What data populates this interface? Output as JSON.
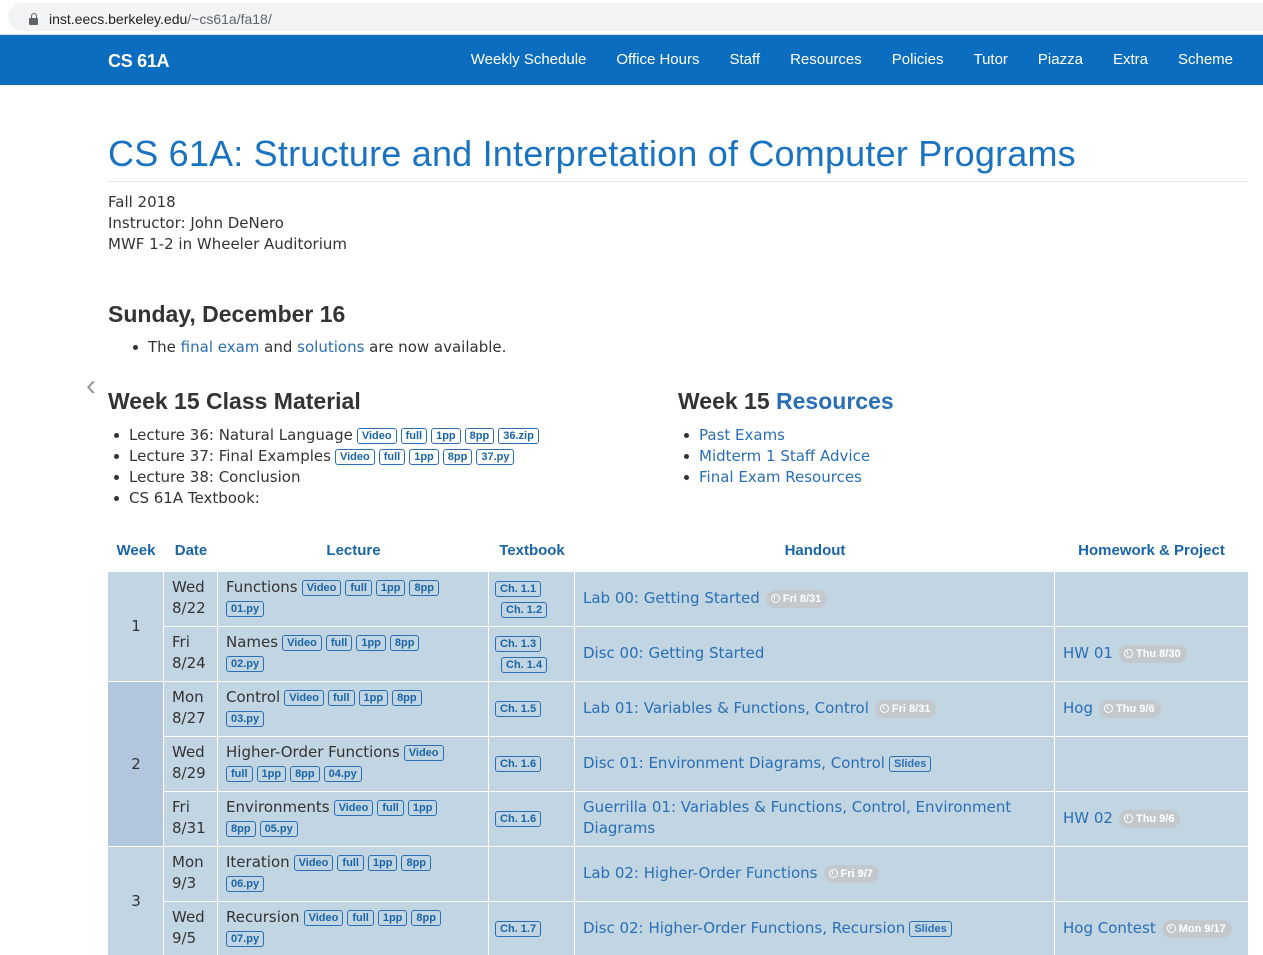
{
  "browser": {
    "host": "inst.eecs.berkeley.edu",
    "path": "/~cs61a/fa18/"
  },
  "nav": {
    "brand": "CS 61A",
    "links": [
      "Weekly Schedule",
      "Office Hours",
      "Staff",
      "Resources",
      "Policies",
      "Tutor",
      "Piazza",
      "Extra",
      "Scheme"
    ]
  },
  "header": {
    "title": "CS 61A: Structure and Interpretation of Computer Programs",
    "term": "Fall 2018",
    "instructor": "Instructor: John DeNero",
    "meeting": "MWF 1-2 in Wheeler Auditorium"
  },
  "announcement": {
    "date": "Sunday, December 16",
    "text_1": "The ",
    "link_1": "final exam",
    "text_2": " and ",
    "link_2": "solutions",
    "text_3": " are now available."
  },
  "material": {
    "heading": "Week 15 Class Material",
    "items": [
      {
        "label": "Lecture 36: Natural Language",
        "tags": [
          "Video",
          "full",
          "1pp",
          "8pp",
          "36.zip"
        ]
      },
      {
        "label": "Lecture 37: Final Examples",
        "tags": [
          "Video",
          "full",
          "1pp",
          "8pp",
          "37.py"
        ]
      },
      {
        "label": "Lecture 38: Conclusion",
        "tags": []
      },
      {
        "label": "CS 61A Textbook:",
        "tags": []
      }
    ]
  },
  "resources": {
    "heading_prefix": "Week 15 ",
    "heading_link": "Resources",
    "items": [
      "Past Exams",
      "Midterm 1 Staff Advice",
      "Final Exam Resources"
    ]
  },
  "table": {
    "headers": [
      "Week",
      "Date",
      "Lecture",
      "Textbook",
      "Handout",
      "Homework & Project"
    ],
    "weeks": [
      "1",
      "2",
      "3"
    ],
    "rows": [
      {
        "day": "Wed",
        "date": "8/22",
        "lecture": "Functions",
        "lec_tags_1": [
          "Video",
          "full",
          "1pp",
          "8pp"
        ],
        "lec_tags_2": [
          "01.py"
        ],
        "text": [
          "Ch. 1.1",
          "Ch. 1.2"
        ],
        "handout": "Lab 00: Getting Started",
        "handout_due": "Fri 8/31",
        "handout_tag": "",
        "hw": "",
        "hw_due": ""
      },
      {
        "day": "Fri",
        "date": "8/24",
        "lecture": "Names",
        "lec_tags_1": [
          "Video",
          "full",
          "1pp",
          "8pp"
        ],
        "lec_tags_2": [
          "02.py"
        ],
        "text": [
          "Ch. 1.3",
          "Ch. 1.4"
        ],
        "handout": "Disc 00: Getting Started",
        "handout_due": "",
        "handout_tag": "",
        "hw": "HW 01",
        "hw_due": "Thu 8/30"
      },
      {
        "day": "Mon",
        "date": "8/27",
        "lecture": "Control",
        "lec_tags_1": [
          "Video",
          "full",
          "1pp",
          "8pp"
        ],
        "lec_tags_2": [
          "03.py"
        ],
        "text": [
          "Ch. 1.5"
        ],
        "handout": "Lab 01: Variables & Functions, Control",
        "handout_due": "Fri 8/31",
        "handout_tag": "",
        "hw": "Hog",
        "hw_due": "Thu 9/6"
      },
      {
        "day": "Wed",
        "date": "8/29",
        "lecture": "Higher-Order Functions",
        "lec_tags_1": [
          "Video"
        ],
        "lec_tags_2": [
          "full",
          "1pp",
          "8pp",
          "04.py"
        ],
        "text": [
          "Ch. 1.6"
        ],
        "handout": "Disc 01: Environment Diagrams, Control",
        "handout_due": "",
        "handout_tag": "Slides",
        "hw": "",
        "hw_due": ""
      },
      {
        "day": "Fri",
        "date": "8/31",
        "lecture": "Environments",
        "lec_tags_1": [
          "Video",
          "full",
          "1pp"
        ],
        "lec_tags_2": [
          "8pp",
          "05.py"
        ],
        "text": [
          "Ch. 1.6"
        ],
        "handout": "Guerrilla 01: Variables & Functions, Control, Environment Diagrams",
        "handout_due": "",
        "handout_tag": "",
        "hw": "HW 02",
        "hw_due": "Thu 9/6"
      },
      {
        "day": "Mon",
        "date": "9/3",
        "lecture": "Iteration",
        "lec_tags_1": [
          "Video",
          "full",
          "1pp",
          "8pp"
        ],
        "lec_tags_2": [
          "06.py"
        ],
        "text": [],
        "handout": "Lab 02: Higher-Order Functions",
        "handout_due": "Fri 9/7",
        "handout_tag": "",
        "hw": "",
        "hw_due": ""
      },
      {
        "day": "Wed",
        "date": "9/5",
        "lecture": "Recursion",
        "lec_tags_1": [
          "Video",
          "full",
          "1pp",
          "8pp"
        ],
        "lec_tags_2": [
          "07.py"
        ],
        "text": [
          "Ch. 1.7"
        ],
        "handout": "Disc 02: Higher-Order Functions, Recursion",
        "handout_due": "",
        "handout_tag": "Slides",
        "hw": "Hog Contest",
        "hw_due": "Mon 9/17"
      }
    ]
  }
}
